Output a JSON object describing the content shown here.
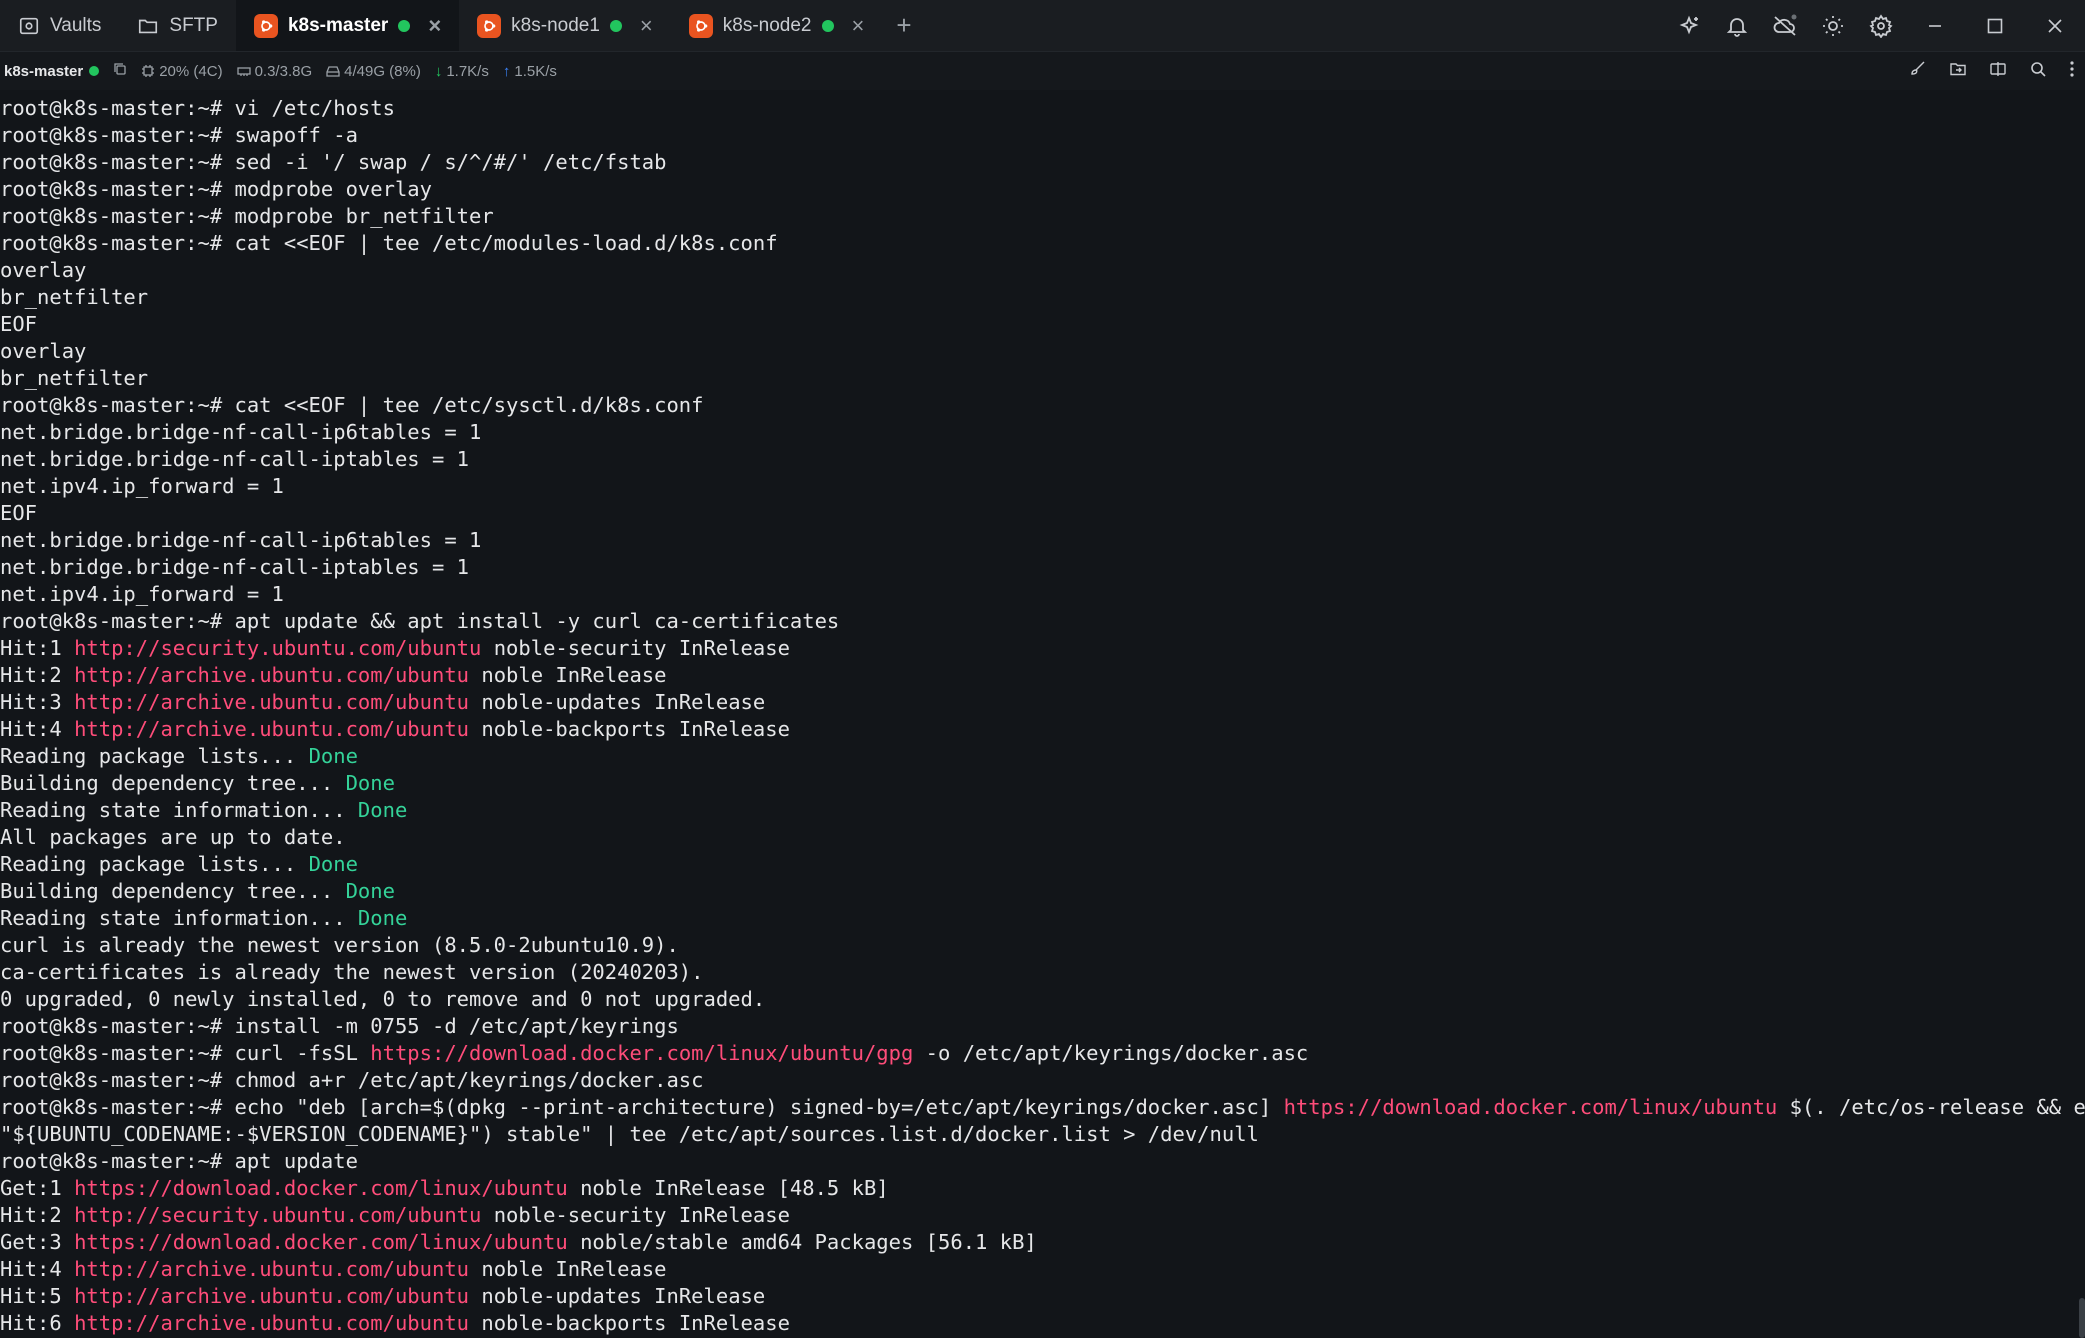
{
  "tabs": [
    {
      "label": "Vaults",
      "icon": "vault-icon",
      "active": false
    },
    {
      "label": "SFTP",
      "icon": "folder-icon",
      "active": false
    },
    {
      "label": "k8s-master",
      "icon": "ubuntu-icon",
      "active": true
    },
    {
      "label": "k8s-node1",
      "icon": "ubuntu-icon",
      "active": false
    },
    {
      "label": "k8s-node2",
      "icon": "ubuntu-icon",
      "active": false
    }
  ],
  "status": {
    "host": "k8s-master",
    "cpu": "20% (4C)",
    "mem": "0.3/3.8G",
    "disk": "4/49G (8%)",
    "down": "1.7K/s",
    "up": "1.5K/s"
  },
  "colors": {
    "accent": "#e95420",
    "online": "#22c55e",
    "url": "#ff4d7a",
    "done": "#34d399"
  },
  "terminal_lines": [
    [
      {
        "t": "root@k8s-master:~# vi /etc/hosts"
      }
    ],
    [
      {
        "t": "root@k8s-master:~# swapoff -a"
      }
    ],
    [
      {
        "t": "root@k8s-master:~# sed -i '/ swap / s/^/#/' /etc/fstab"
      }
    ],
    [
      {
        "t": "root@k8s-master:~# modprobe overlay"
      }
    ],
    [
      {
        "t": "root@k8s-master:~# modprobe br_netfilter"
      }
    ],
    [
      {
        "t": "root@k8s-master:~# cat <<EOF | tee /etc/modules-load.d/k8s.conf"
      }
    ],
    [
      {
        "t": "overlay"
      }
    ],
    [
      {
        "t": "br_netfilter"
      }
    ],
    [
      {
        "t": "EOF"
      }
    ],
    [
      {
        "t": "overlay"
      }
    ],
    [
      {
        "t": "br_netfilter"
      }
    ],
    [
      {
        "t": "root@k8s-master:~# cat <<EOF | tee /etc/sysctl.d/k8s.conf"
      }
    ],
    [
      {
        "t": "net.bridge.bridge-nf-call-ip6tables = 1"
      }
    ],
    [
      {
        "t": "net.bridge.bridge-nf-call-iptables = 1"
      }
    ],
    [
      {
        "t": "net.ipv4.ip_forward = 1"
      }
    ],
    [
      {
        "t": "EOF"
      }
    ],
    [
      {
        "t": "net.bridge.bridge-nf-call-ip6tables = 1"
      }
    ],
    [
      {
        "t": "net.bridge.bridge-nf-call-iptables = 1"
      }
    ],
    [
      {
        "t": "net.ipv4.ip_forward = 1"
      }
    ],
    [
      {
        "t": "root@k8s-master:~# apt update && apt install -y curl ca-certificates"
      }
    ],
    [
      {
        "t": "Hit:1 "
      },
      {
        "t": "http://security.ubuntu.com/ubuntu",
        "c": "url"
      },
      {
        "t": " noble-security InRelease"
      }
    ],
    [
      {
        "t": "Hit:2 "
      },
      {
        "t": "http://archive.ubuntu.com/ubuntu",
        "c": "url"
      },
      {
        "t": " noble InRelease"
      }
    ],
    [
      {
        "t": "Hit:3 "
      },
      {
        "t": "http://archive.ubuntu.com/ubuntu",
        "c": "url"
      },
      {
        "t": " noble-updates InRelease"
      }
    ],
    [
      {
        "t": "Hit:4 "
      },
      {
        "t": "http://archive.ubuntu.com/ubuntu",
        "c": "url"
      },
      {
        "t": " noble-backports InRelease"
      }
    ],
    [
      {
        "t": "Reading package lists... "
      },
      {
        "t": "Done",
        "c": "done"
      }
    ],
    [
      {
        "t": "Building dependency tree... "
      },
      {
        "t": "Done",
        "c": "done"
      }
    ],
    [
      {
        "t": "Reading state information... "
      },
      {
        "t": "Done",
        "c": "done"
      }
    ],
    [
      {
        "t": "All packages are up to date."
      }
    ],
    [
      {
        "t": "Reading package lists... "
      },
      {
        "t": "Done",
        "c": "done"
      }
    ],
    [
      {
        "t": "Building dependency tree... "
      },
      {
        "t": "Done",
        "c": "done"
      }
    ],
    [
      {
        "t": "Reading state information... "
      },
      {
        "t": "Done",
        "c": "done"
      }
    ],
    [
      {
        "t": "curl is already the newest version (8.5.0-2ubuntu10.9)."
      }
    ],
    [
      {
        "t": "ca-certificates is already the newest version (20240203)."
      }
    ],
    [
      {
        "t": "0 upgraded, 0 newly installed, 0 to remove and 0 not upgraded."
      }
    ],
    [
      {
        "t": "root@k8s-master:~# install -m 0755 -d /etc/apt/keyrings"
      }
    ],
    [
      {
        "t": "root@k8s-master:~# curl -fsSL "
      },
      {
        "t": "https://download.docker.com/linux/ubuntu/gpg",
        "c": "url"
      },
      {
        "t": " -o /etc/apt/keyrings/docker.asc"
      }
    ],
    [
      {
        "t": "root@k8s-master:~# chmod a+r /etc/apt/keyrings/docker.asc"
      }
    ],
    [
      {
        "t": "root@k8s-master:~# echo \"deb [arch=$(dpkg --print-architecture) signed-by=/etc/apt/keyrings/docker.asc] "
      },
      {
        "t": "https://download.docker.com/linux/ubuntu",
        "c": "url"
      },
      {
        "t": " $(. /etc/os-release && echo"
      }
    ],
    [
      {
        "t": "\"${UBUNTU_CODENAME:-$VERSION_CODENAME}\") stable\" | tee /etc/apt/sources.list.d/docker.list > /dev/null"
      }
    ],
    [
      {
        "t": "root@k8s-master:~# apt update"
      }
    ],
    [
      {
        "t": "Get:1 "
      },
      {
        "t": "https://download.docker.com/linux/ubuntu",
        "c": "url"
      },
      {
        "t": " noble InRelease [48.5 kB]"
      }
    ],
    [
      {
        "t": "Hit:2 "
      },
      {
        "t": "http://security.ubuntu.com/ubuntu",
        "c": "url"
      },
      {
        "t": " noble-security InRelease"
      }
    ],
    [
      {
        "t": "Get:3 "
      },
      {
        "t": "https://download.docker.com/linux/ubuntu",
        "c": "url"
      },
      {
        "t": " noble/stable amd64 Packages [56.1 kB]"
      }
    ],
    [
      {
        "t": "Hit:4 "
      },
      {
        "t": "http://archive.ubuntu.com/ubuntu",
        "c": "url"
      },
      {
        "t": " noble InRelease"
      }
    ],
    [
      {
        "t": "Hit:5 "
      },
      {
        "t": "http://archive.ubuntu.com/ubuntu",
        "c": "url"
      },
      {
        "t": " noble-updates InRelease"
      }
    ],
    [
      {
        "t": "Hit:6 "
      },
      {
        "t": "http://archive.ubuntu.com/ubuntu",
        "c": "url"
      },
      {
        "t": " noble-backports InRelease"
      }
    ]
  ]
}
